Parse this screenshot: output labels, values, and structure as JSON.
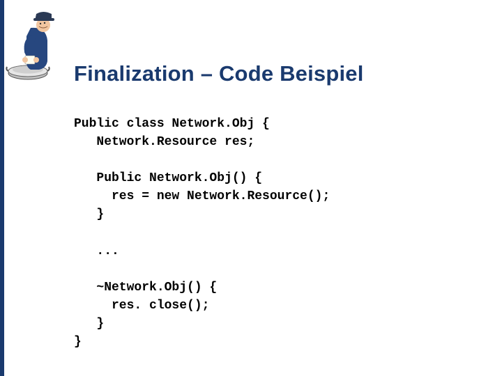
{
  "title": "Finalization – Code Beispiel",
  "code": "Public class Network.Obj {\n   Network.Resource res;\n\n   Public Network.Obj() {\n     res = new Network.Resource();\n   }\n\n   ...\n\n   ~Network.Obj() {\n     res. close();\n   }\n}",
  "logo": {
    "description": "figure-in-hat-over-bowl"
  }
}
